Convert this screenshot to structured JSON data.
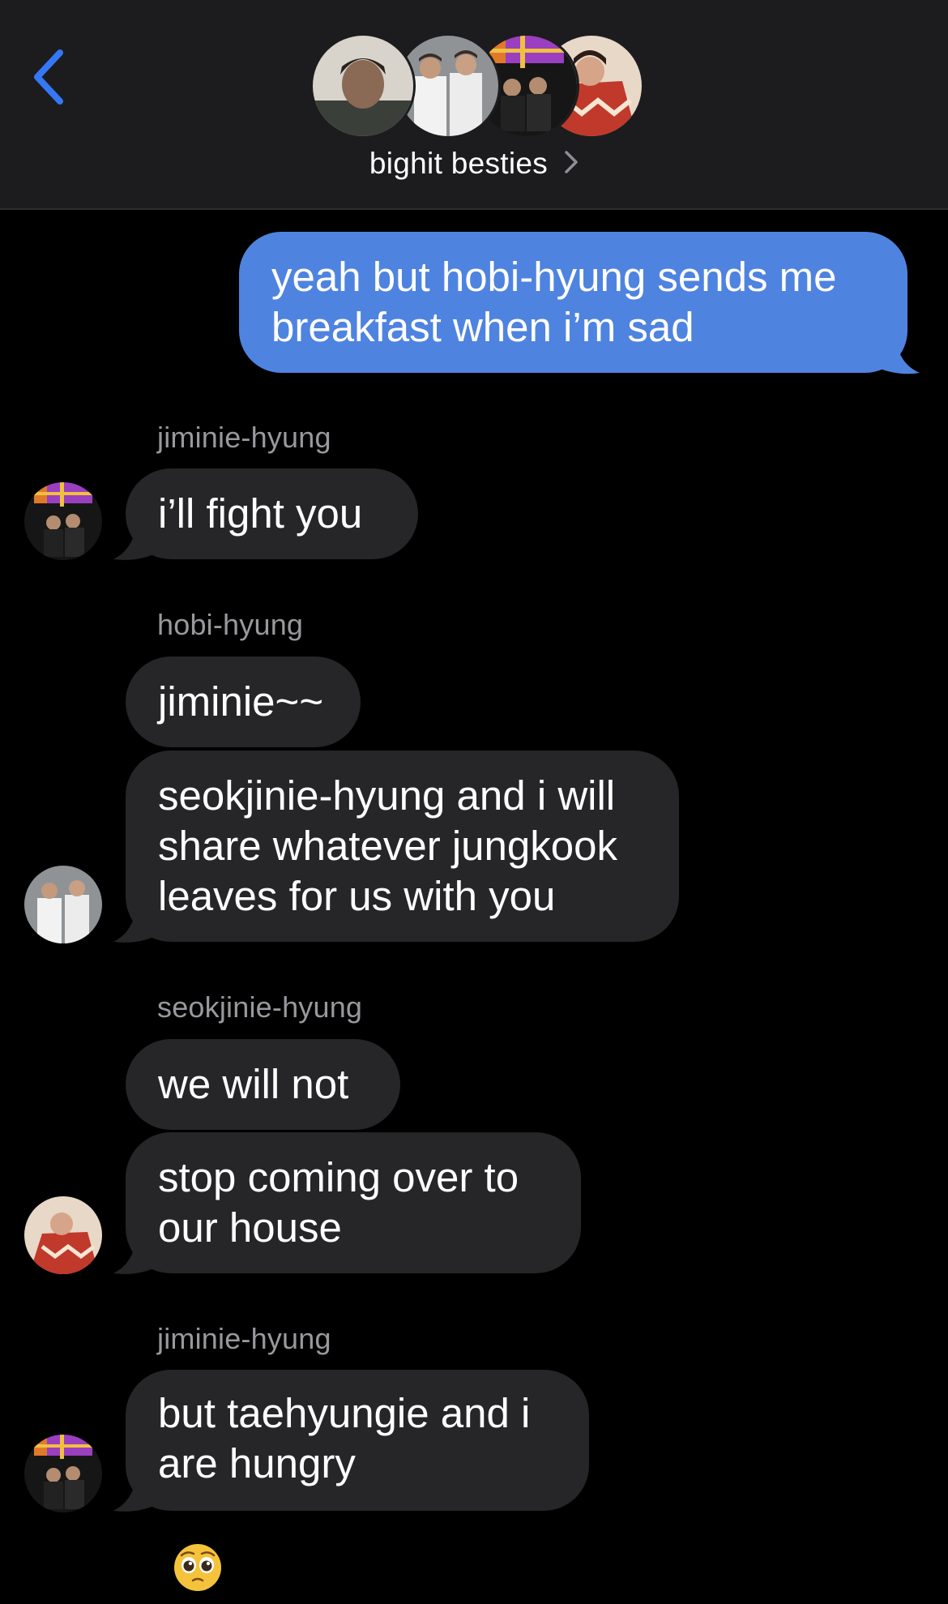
{
  "header": {
    "title": "bighit besties",
    "back_icon": "chevron-left-icon",
    "chevron_icon": "chevron-right-icon",
    "accent_color": "#3478f6"
  },
  "messages": [
    {
      "direction": "outgoing",
      "text": "yeah but hobi-hyung sends me\nbreakfast when i’m sad"
    },
    {
      "direction": "incoming",
      "sender": "jiminie-hyung",
      "text": "i’ll fight you"
    },
    {
      "direction": "incoming",
      "sender": "hobi-hyung",
      "text": "jiminie~~"
    },
    {
      "direction": "incoming",
      "text": "seokjinie-hyung and i will\nshare whatever jungkook\nleaves for us with you"
    },
    {
      "direction": "incoming",
      "sender": "seokjinie-hyung",
      "text": "we will not"
    },
    {
      "direction": "incoming",
      "text": "stop coming over to\nour house"
    },
    {
      "direction": "incoming",
      "sender": "jiminie-hyung",
      "text": "but taehyungie and i\nare hungry"
    }
  ],
  "colors": {
    "outgoing_bubble": "#4f83e0",
    "incoming_bubble": "#262628",
    "header_bg": "#1c1c1e",
    "sender_name": "#98989d"
  },
  "emoji": "pleading-face-emoji"
}
